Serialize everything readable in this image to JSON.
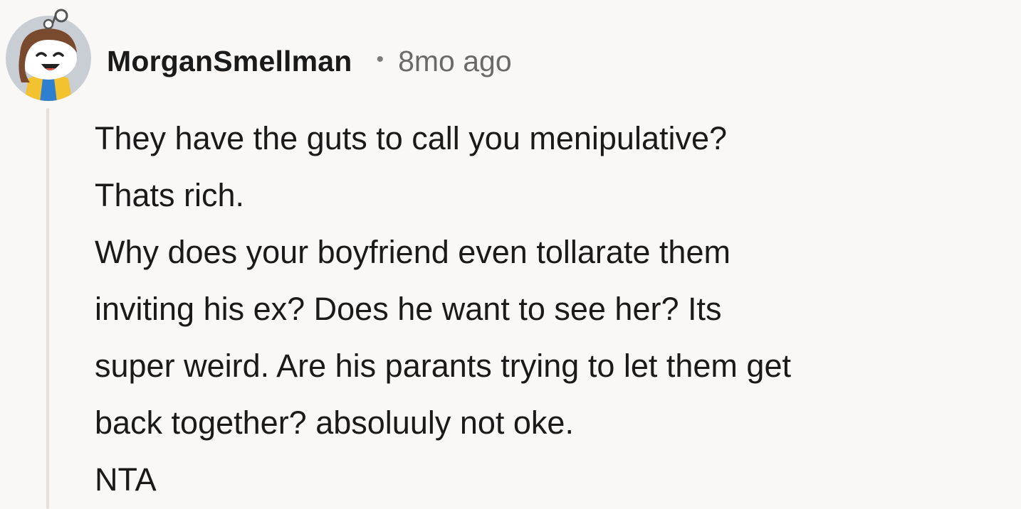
{
  "comment": {
    "author": "MorganSmellman",
    "separator": "•",
    "timestamp": "8mo ago",
    "avatar_icon": "snoo-avatar-icon",
    "lines": [
      "They have the guts to call you menipulative?",
      "Thats rich.",
      "Why does your boyfriend even tollarate them",
      "inviting his ex? Does he want to see her? Its",
      "super weird. Are his parants trying to let them get",
      "back together? absoluuly not oke.",
      "NTA"
    ]
  },
  "colors": {
    "background": "#f9f8f6",
    "thread_line": "#e6e0d9",
    "text": "#1a1a1b",
    "meta_text": "#6a6a6a",
    "avatar_bg": "#c9ced4"
  }
}
